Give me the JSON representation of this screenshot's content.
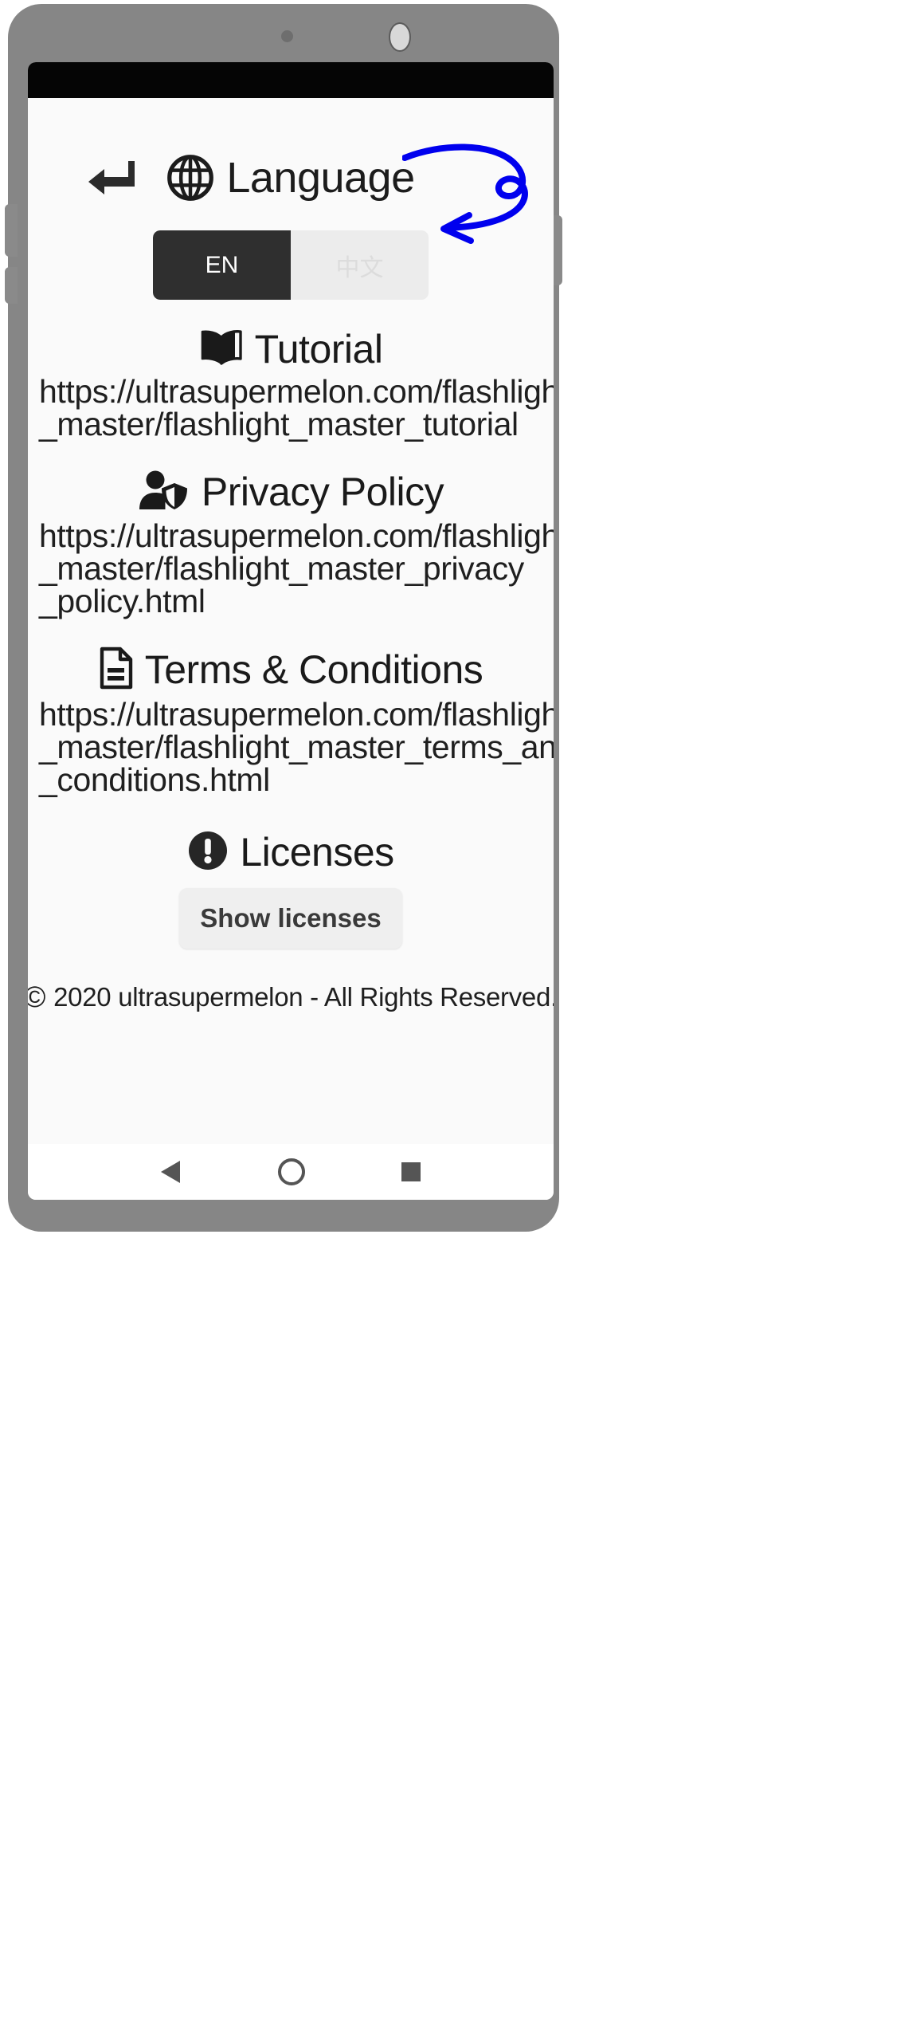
{
  "app": {
    "title": "Language",
    "title_icon": "globe-icon",
    "back_icon": "back-arrow-icon"
  },
  "language_toggle": {
    "options": [
      {
        "label": "EN",
        "selected": true
      },
      {
        "label": "中文",
        "selected": false
      }
    ],
    "active_bg": "#2f2f2f",
    "inactive_bg": "#ececec",
    "inactive_text": "#dcdcdc"
  },
  "sections": [
    {
      "id": "tutorial",
      "icon": "open-book-icon",
      "title": "Tutorial",
      "url_lines": [
        "https://ultrasupermelon.com/flashlight",
        "_master/flashlight_master_tutorial"
      ]
    },
    {
      "id": "privacy-policy",
      "icon": "person-shield-icon",
      "title": "Privacy Policy",
      "url_lines": [
        "https://ultrasupermelon.com/flashlight",
        "_master/flashlight_master_privacy",
        "_policy.html"
      ]
    },
    {
      "id": "terms-conditions",
      "icon": "document-icon",
      "title": "Terms & Conditions",
      "url_lines": [
        "https://ultrasupermelon.com/flashlight",
        "_master/flashlight_master_terms_and",
        "_conditions.html"
      ]
    }
  ],
  "licenses": {
    "icon": "exclamation-circle-icon",
    "title": "Licenses",
    "button_label": "Show licenses"
  },
  "footer": {
    "copyright_symbol": "©",
    "copyright_text": "2020 ultrasupermelon - All Rights Reserved."
  },
  "nav_bar": {
    "back": "triangle-back-icon",
    "home": "circle-home-icon",
    "recents": "square-recents-icon"
  },
  "annotation": {
    "type": "hand-drawn-arrow",
    "color": "#0000ee",
    "points_to": "language-toggle"
  },
  "colors": {
    "phone_body": "#868686",
    "screen_bg": "#fafafa",
    "status_bar": "#050505",
    "text": "#1c1c1c"
  }
}
